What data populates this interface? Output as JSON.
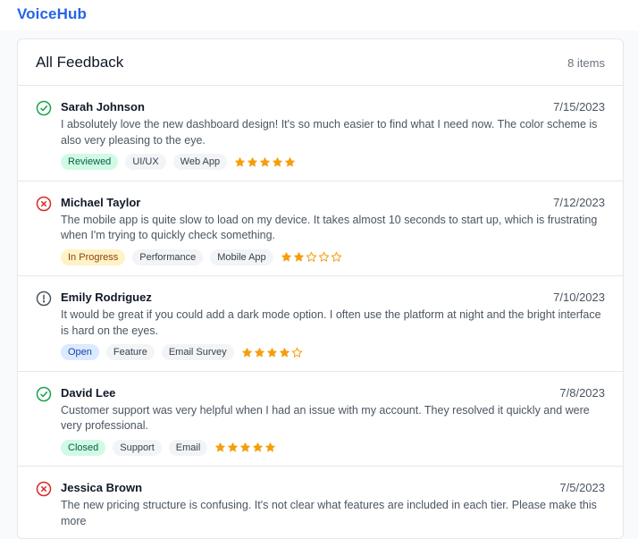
{
  "app": {
    "title": "VoiceHub"
  },
  "panel": {
    "title": "All Feedback",
    "count": "8 items"
  },
  "colors": {
    "brand": "#2563eb",
    "star": "#f59e0b",
    "positive": "#16a34a",
    "negative": "#dc2626",
    "neutral": "#4b5563"
  },
  "items": [
    {
      "icon": "check-circle-icon",
      "icon_color": "#16a34a",
      "name": "Sarah Johnson",
      "date": "7/15/2023",
      "text": "I absolutely love the new dashboard design! It's so much easier to find what I need now. The color scheme is also very pleasing to the eye.",
      "status": "Reviewed",
      "status_bg": "#d1fae5",
      "status_fg": "#065f46",
      "category": "UI/UX",
      "channel": "Web App",
      "rating": 5
    },
    {
      "icon": "x-circle-icon",
      "icon_color": "#dc2626",
      "name": "Michael Taylor",
      "date": "7/12/2023",
      "text": "The mobile app is quite slow to load on my device. It takes almost 10 seconds to start up, which is frustrating when I'm trying to quickly check something.",
      "status": "In Progress",
      "status_bg": "#fef3c7",
      "status_fg": "#92400e",
      "category": "Performance",
      "channel": "Mobile App",
      "rating": 2
    },
    {
      "icon": "alert-circle-icon",
      "icon_color": "#4b5563",
      "name": "Emily Rodriguez",
      "date": "7/10/2023",
      "text": "It would be great if you could add a dark mode option. I often use the platform at night and the bright interface is hard on the eyes.",
      "status": "Open",
      "status_bg": "#dbeafe",
      "status_fg": "#1e40af",
      "category": "Feature",
      "channel": "Email Survey",
      "rating": 4
    },
    {
      "icon": "check-circle-icon",
      "icon_color": "#16a34a",
      "name": "David Lee",
      "date": "7/8/2023",
      "text": "Customer support was very helpful when I had an issue with my account. They resolved it quickly and were very professional.",
      "status": "Closed",
      "status_bg": "#d1fae5",
      "status_fg": "#065f46",
      "category": "Support",
      "channel": "Email",
      "rating": 5
    },
    {
      "icon": "x-circle-icon",
      "icon_color": "#dc2626",
      "name": "Jessica Brown",
      "date": "7/5/2023",
      "text": "The new pricing structure is confusing. It's not clear what features are included in each tier. Please make this more",
      "status": "",
      "status_bg": "#f3f4f6",
      "status_fg": "#374151",
      "category": "",
      "channel": "",
      "rating": 0
    }
  ]
}
